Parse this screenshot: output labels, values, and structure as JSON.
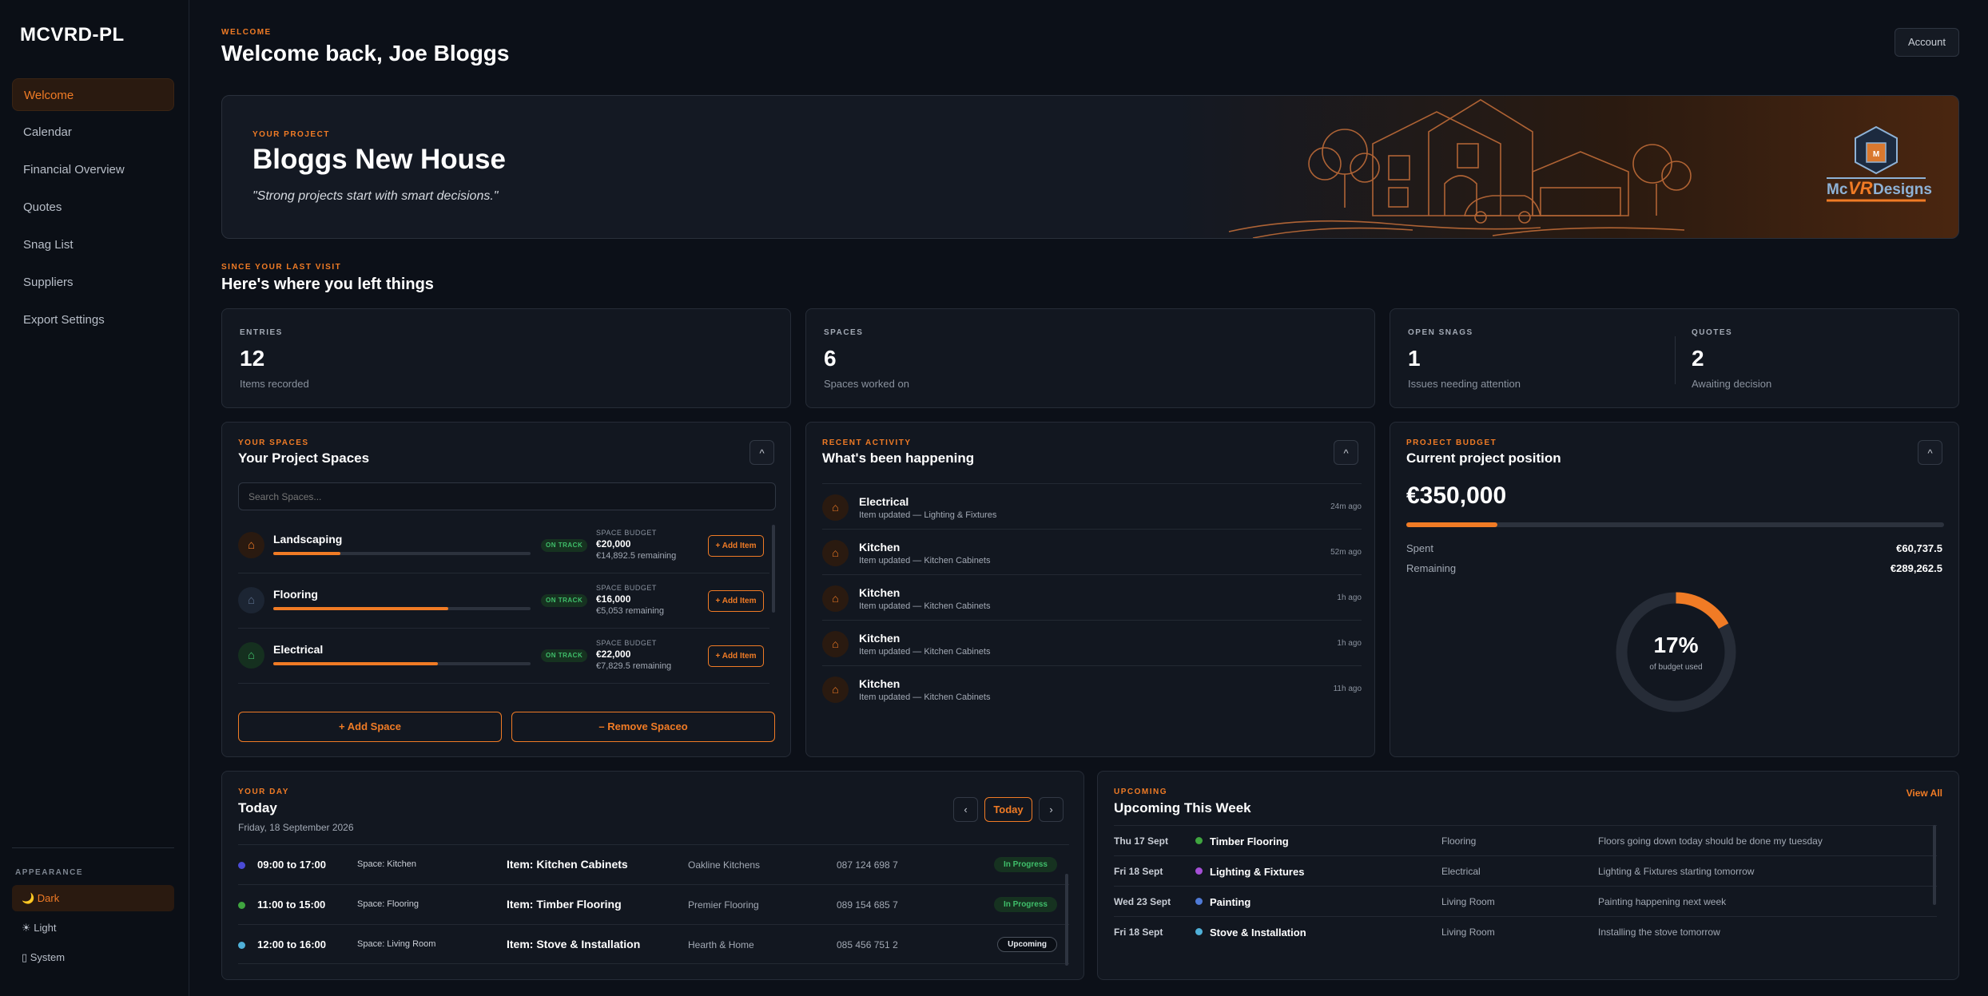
{
  "sidebar": {
    "brand": "MCVRD-PL",
    "nav": [
      "Welcome",
      "Calendar",
      "Financial Overview",
      "Quotes",
      "Snag List",
      "Suppliers",
      "Export Settings"
    ],
    "appearance_label": "APPEARANCE",
    "themes": [
      "🌙 Dark",
      "☀ Light",
      "▯ System"
    ]
  },
  "header": {
    "eyebrow": "WELCOME",
    "title": "Welcome back, Joe Bloggs",
    "account_label": "Account"
  },
  "hero": {
    "eyebrow": "YOUR PROJECT",
    "title": "Bloggs New House",
    "quote": "\"Strong projects start with smart decisions.\"",
    "logo_text_left": "Mc",
    "logo_text_vr": "VR",
    "logo_text_right": "Designs"
  },
  "since": {
    "eyebrow": "SINCE YOUR LAST VISIT",
    "title": "Here's where you left things"
  },
  "stats": {
    "entries": {
      "label": "ENTRIES",
      "value": "12",
      "sub": "Items recorded"
    },
    "spaces": {
      "label": "SPACES",
      "value": "6",
      "sub": "Spaces worked on"
    },
    "snags": {
      "label": "OPEN SNAGS",
      "value": "1",
      "sub": "Issues needing attention"
    },
    "quotes": {
      "label": "QUOTES",
      "value": "2",
      "sub": "Awaiting decision"
    }
  },
  "spaces_card": {
    "eyebrow": "YOUR SPACES",
    "title": "Your Project Spaces",
    "collapse": "^",
    "search_placeholder": "Search Spaces...",
    "status_label": "ON TRACK",
    "budget_label": "SPACE BUDGET",
    "add_item_label": "+ Add Item",
    "items": [
      {
        "name": "Landscaping",
        "budget": "€20,000",
        "remaining": "€14,892.5 remaining",
        "progress": 0.26,
        "icon_color": "#f07b25",
        "icon_bg": "#2a1a10"
      },
      {
        "name": "Flooring",
        "budget": "€16,000",
        "remaining": "€5,053 remaining",
        "progress": 0.68,
        "icon_color": "#5a6d8a",
        "icon_bg": "#1c2533"
      },
      {
        "name": "Electrical",
        "budget": "€22,000",
        "remaining": "€7,829.5 remaining",
        "progress": 0.64,
        "icon_color": "#3fbf6a",
        "icon_bg": "#15301f"
      }
    ],
    "add_space_label": "+ Add Space",
    "remove_space_label": "– Remove Spaceo"
  },
  "activity_card": {
    "eyebrow": "RECENT ACTIVITY",
    "title": "What's been happening",
    "collapse": "^",
    "items": [
      {
        "title": "Electrical",
        "sub": "Item updated — Lighting & Fixtures",
        "time": "24m ago"
      },
      {
        "title": "Kitchen",
        "sub": "Item updated — Kitchen Cabinets",
        "time": "52m ago"
      },
      {
        "title": "Kitchen",
        "sub": "Item updated — Kitchen Cabinets",
        "time": "1h ago"
      },
      {
        "title": "Kitchen",
        "sub": "Item updated — Kitchen Cabinets",
        "time": "1h ago"
      },
      {
        "title": "Kitchen",
        "sub": "Item updated — Kitchen Cabinets",
        "time": "11h ago"
      }
    ]
  },
  "budget_card": {
    "eyebrow": "PROJECT BUDGET",
    "title": "Current project position",
    "collapse": "^",
    "total": "€350,000",
    "used_fraction": 0.17,
    "spent_label": "Spent",
    "spent_value": "€60,737.5",
    "remaining_label": "Remaining",
    "remaining_value": "€289,262.5",
    "donut_pct": "17%",
    "donut_sub": "of budget used"
  },
  "day_card": {
    "eyebrow": "YOUR DAY",
    "title": "Today",
    "date": "Friday, 18 September 2026",
    "prev": "‹",
    "today_label": "Today",
    "next": "›",
    "rows": [
      {
        "time": "09:00 to 17:00",
        "space": "Space: Kitchen",
        "item_prefix": "Item:",
        "item": "Kitchen Cabinets",
        "supplier": "Oakline Kitchens",
        "phone": "087 124 698 7",
        "status": "In Progress",
        "dot": "#4b4bd6"
      },
      {
        "time": "11:00 to 15:00",
        "space": "Space: Flooring",
        "item_prefix": "Item:",
        "item": "Timber Flooring",
        "supplier": "Premier Flooring",
        "phone": "089 154 685 7",
        "status": "In Progress",
        "dot": "#3fa53f"
      },
      {
        "time": "12:00 to 16:00",
        "space": "Space: Living Room",
        "item_prefix": "Item:",
        "item": "Stove & Installation",
        "supplier": "Hearth & Home",
        "phone": "085 456 751 2",
        "status": "Upcoming",
        "dot": "#4fb0d8"
      }
    ]
  },
  "upcoming_card": {
    "eyebrow": "UPCOMING",
    "title": "Upcoming This Week",
    "view_all": "View All",
    "rows": [
      {
        "date": "Thu 17 Sept",
        "name": "Timber Flooring",
        "area": "Flooring",
        "note": "Floors going down today should be done my tuesday",
        "dot": "#3fa53f"
      },
      {
        "date": "Fri 18 Sept",
        "name": "Lighting & Fixtures",
        "area": "Electrical",
        "note": "Lighting & Fixtures starting tomorrow",
        "dot": "#a54fd6"
      },
      {
        "date": "Wed 23 Sept",
        "name": "Painting",
        "area": "Living Room",
        "note": "Painting happening next week",
        "dot": "#4f7ad6"
      },
      {
        "date": "Fri 18 Sept",
        "name": "Stove & Installation",
        "area": "Living Room",
        "note": "Installing the stove tomorrow",
        "dot": "#4fb0d8"
      }
    ]
  },
  "colors": {
    "accent": "#f07b25",
    "background": "#0c1018",
    "card": "#121720",
    "success": "#3fbf6a"
  }
}
